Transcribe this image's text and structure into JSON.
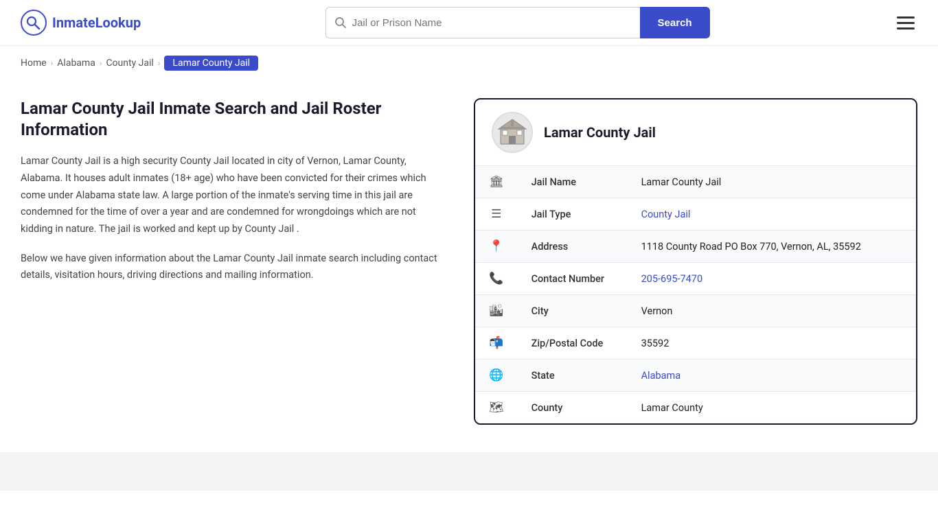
{
  "logo": {
    "text_part1": "Inmate",
    "text_part2": "Lookup",
    "alt": "InmateLookup logo"
  },
  "search": {
    "placeholder": "Jail or Prison Name",
    "button_label": "Search"
  },
  "breadcrumb": {
    "items": [
      {
        "label": "Home",
        "href": "#"
      },
      {
        "label": "Alabama",
        "href": "#"
      },
      {
        "label": "County Jail",
        "href": "#"
      },
      {
        "label": "Lamar County Jail",
        "active": true
      }
    ]
  },
  "page": {
    "title": "Lamar County Jail Inmate Search and Jail Roster Information",
    "description": "Lamar County Jail is a high security County Jail located in city of Vernon, Lamar County, Alabama. It houses adult inmates (18+ age) who have been convicted for their crimes which come under Alabama state law. A large portion of the inmate's serving time in this jail are condemned for the time of over a year and are condemned for wrongdoings which are not kidding in nature. The jail is worked and kept up by County Jail .",
    "sub_description": "Below we have given information about the Lamar County Jail inmate search including contact details, visitation hours, driving directions and mailing information."
  },
  "panel": {
    "title": "Lamar County Jail",
    "rows": [
      {
        "icon": "🏛",
        "icon_name": "jail-icon",
        "label": "Jail Name",
        "value": "Lamar County Jail",
        "link": null
      },
      {
        "icon": "☰",
        "icon_name": "type-icon",
        "label": "Jail Type",
        "value": "County Jail",
        "link": "#"
      },
      {
        "icon": "📍",
        "icon_name": "address-icon",
        "label": "Address",
        "value": "1118 County Road PO Box 770, Vernon, AL, 35592",
        "link": null
      },
      {
        "icon": "📞",
        "icon_name": "phone-icon",
        "label": "Contact Number",
        "value": "205-695-7470",
        "link": "tel:2056957470"
      },
      {
        "icon": "🏙",
        "icon_name": "city-icon",
        "label": "City",
        "value": "Vernon",
        "link": null
      },
      {
        "icon": "📬",
        "icon_name": "zip-icon",
        "label": "Zip/Postal Code",
        "value": "35592",
        "link": null
      },
      {
        "icon": "🌐",
        "icon_name": "state-icon",
        "label": "State",
        "value": "Alabama",
        "link": "#"
      },
      {
        "icon": "🗺",
        "icon_name": "county-icon",
        "label": "County",
        "value": "Lamar County",
        "link": null
      }
    ]
  }
}
